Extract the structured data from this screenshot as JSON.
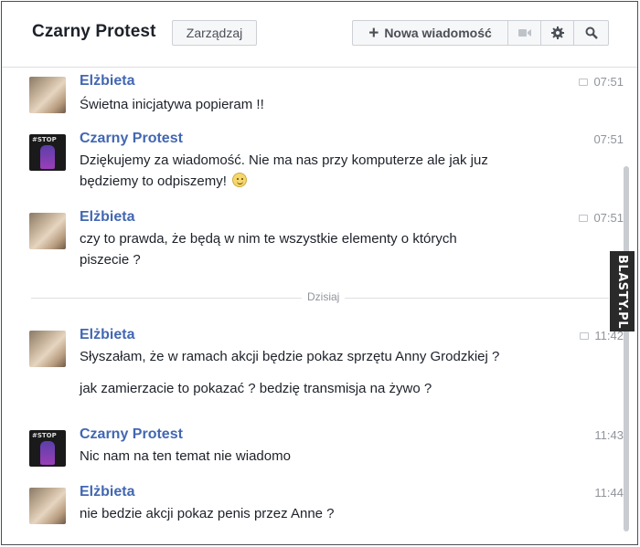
{
  "header": {
    "title": "Czarny Protest",
    "manage_label": "Zarządzaj",
    "new_message_label": "Nowa wiadomość",
    "icons": {
      "new": "plus-icon",
      "video": "video-icon",
      "settings": "gear-icon",
      "search": "search-icon"
    }
  },
  "messages": [
    {
      "sender": "Elżbieta",
      "avatar": "person-photo",
      "time": "07:51",
      "seen_icon": true,
      "lines": [
        "Świetna inicjatywa popieram !!"
      ]
    },
    {
      "sender": "Czarny Protest",
      "avatar": "stop-protest-logo",
      "time": "07:51",
      "seen_icon": false,
      "lines": [
        "Dziękujemy za wiadomość. Nie ma nas przy komputerze ale jak juz",
        "będziemy to odpiszemy!"
      ],
      "emoji": "smiley-icon"
    },
    {
      "sender": "Elżbieta",
      "avatar": "person-photo",
      "time": "07:51",
      "seen_icon": true,
      "lines": [
        "czy to prawda, że będą w nim te wszystkie elementy o których",
        "piszecie ?"
      ]
    },
    {
      "sender": "Elżbieta",
      "avatar": "person-photo",
      "time": "11:42",
      "seen_icon": true,
      "lines": [
        "Słyszałam, że w ramach akcji będzie pokaz sprzętu Anny Grodzkiej ?",
        "jak zamierzacie to pokazać ? bedzię transmisja na żywo ?"
      ]
    },
    {
      "sender": "Czarny Protest",
      "avatar": "stop-protest-logo",
      "time": "11:43",
      "seen_icon": false,
      "lines": [
        "Nic nam na ten temat nie wiadomo"
      ]
    },
    {
      "sender": "Elżbieta",
      "avatar": "person-photo",
      "time": "11:44",
      "seen_icon": false,
      "lines": [
        "nie bedzie akcji pokaz penis przez Anne ?"
      ]
    }
  ],
  "divider_label": "Dzisiaj",
  "avatar_logo_text": "#STOP",
  "watermark": "BLASTY.PL",
  "colors": {
    "name": "#4267b2",
    "text": "#1d2129",
    "time": "#90949c",
    "border": "#dddfe2"
  }
}
